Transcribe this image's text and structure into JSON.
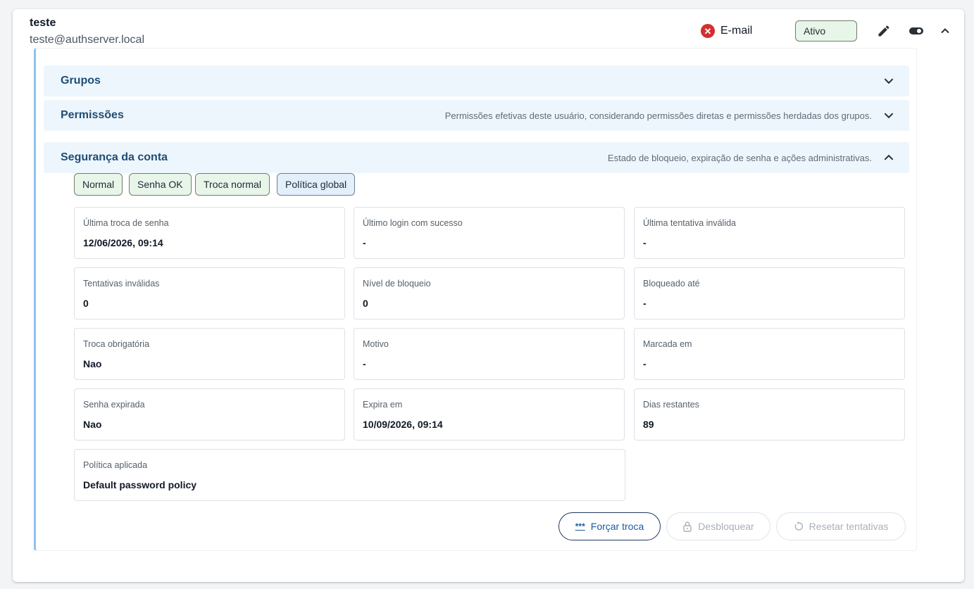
{
  "user": {
    "name": "teste",
    "email": "teste@authserver.local",
    "email_status_label": "E-mail",
    "status": "Ativo"
  },
  "icons": {
    "email_status": "x-circle-icon",
    "edit": "pencil-icon",
    "toggle": "toggle-icon",
    "collapse": "chevron-up-icon"
  },
  "sections": {
    "groups": {
      "title": "Grupos"
    },
    "permissions": {
      "title": "Permissões",
      "description": "Permissões efetivas deste usuário, considerando permissões diretas e permissões herdadas dos grupos."
    },
    "security": {
      "title": "Segurança da conta",
      "description": "Estado de bloqueio, expiração de senha e ações administrativas."
    }
  },
  "chips": [
    "Normal",
    "Senha OK",
    "Troca normal",
    "Política global"
  ],
  "fields": [
    {
      "label": "Última troca de senha",
      "value": "12/06/2026, 09:14"
    },
    {
      "label": "Último login com sucesso",
      "value": "-"
    },
    {
      "label": "Última tentativa inválida",
      "value": "-"
    },
    {
      "label": "Tentativas inválidas",
      "value": "0"
    },
    {
      "label": "Nível de bloqueio",
      "value": "0"
    },
    {
      "label": "Bloqueado até",
      "value": "-"
    },
    {
      "label": "Troca obrigatória",
      "value": "Nao"
    },
    {
      "label": "Motivo",
      "value": "-"
    },
    {
      "label": "Marcada em",
      "value": "-"
    },
    {
      "label": "Senha expirada",
      "value": "Nao"
    },
    {
      "label": "Expira em",
      "value": "10/09/2026, 09:14"
    },
    {
      "label": "Dias restantes",
      "value": "89"
    },
    {
      "label": "Política aplicada",
      "value": "Default password policy"
    }
  ],
  "actions": {
    "force_change": {
      "label": "Forçar troca",
      "glyph": "***",
      "enabled": true
    },
    "unlock": {
      "label": "Desbloquear",
      "enabled": false
    },
    "reset_attempts": {
      "label": "Resetar tentativas",
      "enabled": false
    }
  },
  "colors": {
    "accent": "#1e4d74",
    "error": "#d32f2f",
    "status_bg": "#e8f5e9",
    "section_bg": "#eef6fd",
    "panel_border": "#90c2ec"
  }
}
